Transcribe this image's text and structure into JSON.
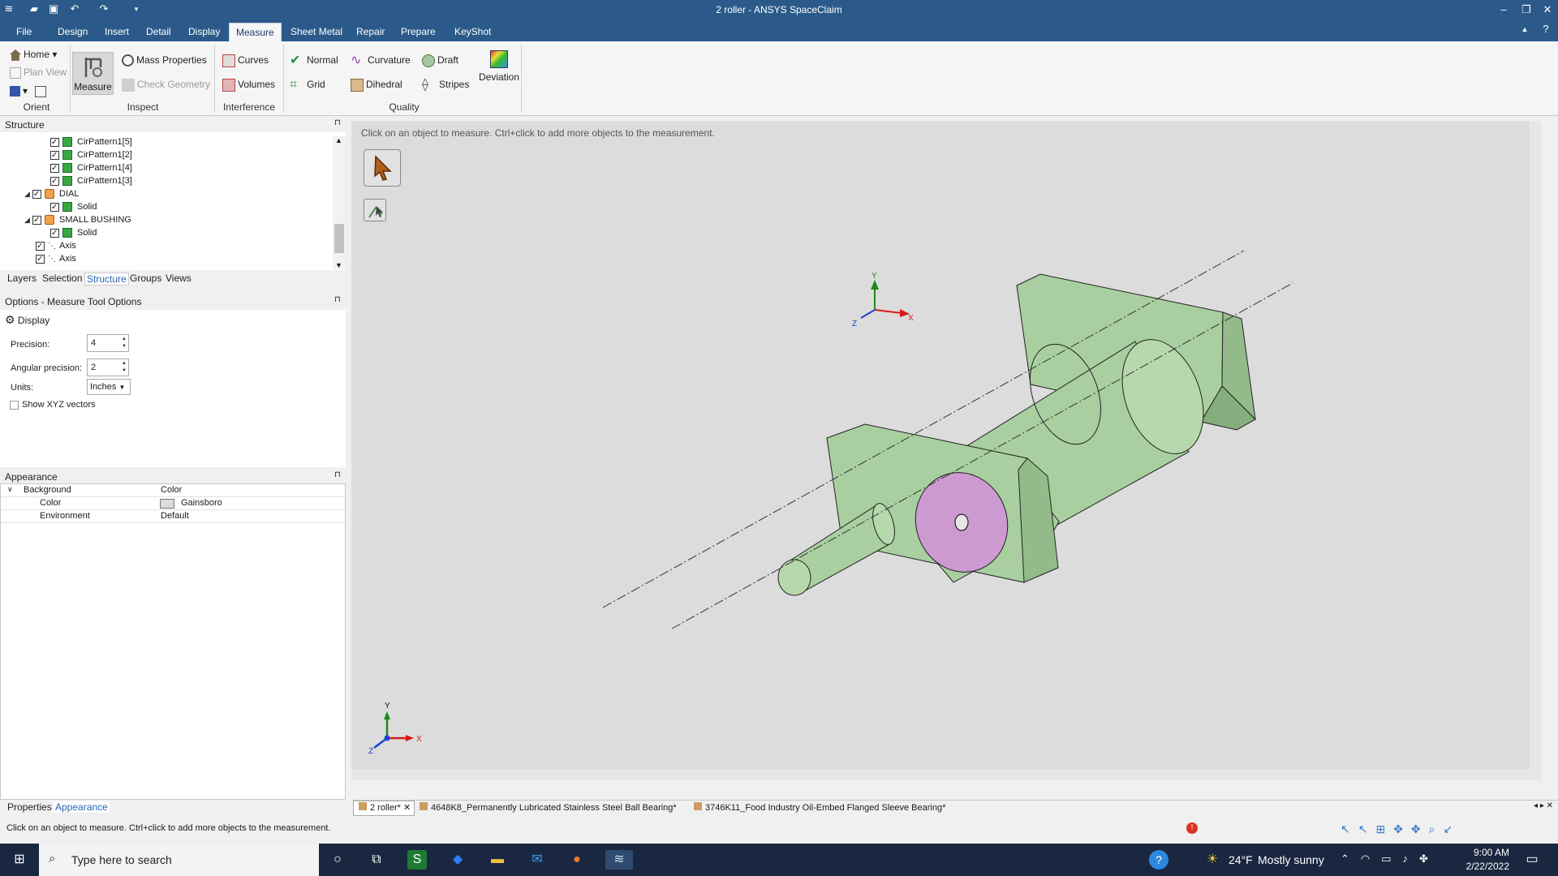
{
  "app": {
    "title": "2 roller - ANSYS SpaceClaim",
    "accent": "#2b5a8a"
  },
  "menu": {
    "tabs": [
      "File",
      "Design",
      "Insert",
      "Detail",
      "Display",
      "Measure",
      "Sheet Metal",
      "Repair",
      "Prepare",
      "KeyShot"
    ],
    "active": "Measure"
  },
  "ribbon": {
    "orient": {
      "home": "Home",
      "plan_view": "Plan View",
      "group": "Orient"
    },
    "inspect": {
      "measure": "Measure",
      "mass_properties": "Mass Properties",
      "check_geometry": "Check Geometry",
      "group": "Inspect"
    },
    "interference": {
      "curves": "Curves",
      "volumes": "Volumes",
      "group": "Interference"
    },
    "quality": {
      "normal": "Normal",
      "grid": "Grid",
      "curvature": "Curvature",
      "dihedral": "Dihedral",
      "draft": "Draft",
      "stripes": "Stripes",
      "deviation": "Deviation",
      "group": "Quality"
    }
  },
  "structure": {
    "title": "Structure",
    "items": [
      {
        "label": "CirPattern1[5]"
      },
      {
        "label": "CirPattern1[2]"
      },
      {
        "label": "CirPattern1[4]"
      },
      {
        "label": "CirPattern1[3]"
      },
      {
        "label": "DIAL"
      },
      {
        "label": "Solid"
      },
      {
        "label": "SMALL BUSHING"
      },
      {
        "label": "Solid"
      },
      {
        "label": "Axis"
      },
      {
        "label": "Axis"
      }
    ]
  },
  "panel_tabs": [
    "Layers",
    "Selection",
    "Structure",
    "Groups",
    "Views"
  ],
  "options": {
    "title": "Options - Measure Tool Options",
    "display": "Display",
    "precision_label": "Precision:",
    "precision_value": "4",
    "angular_label": "Angular precision:",
    "angular_value": "2",
    "units_label": "Units:",
    "units_value": "Inches",
    "xyz_label": "Show XYZ vectors"
  },
  "appearance": {
    "title": "Appearance",
    "header_name": "Background",
    "header_value": "Color",
    "rows": [
      {
        "name": "Color",
        "value": "Gainsboro"
      },
      {
        "name": "Environment",
        "value": "Default"
      }
    ]
  },
  "bottom_tabs": [
    "Properties",
    "Appearance"
  ],
  "viewport": {
    "hint": "Click on an object to measure.  Ctrl+click to add more objects to the measurement.",
    "axis_x": "X",
    "axis_y": "Y",
    "axis_z": "Z"
  },
  "doc_tabs": [
    "2 roller*",
    "4648K8_Permanently Lubricated Stainless Steel Ball Bearing*",
    "3746K11_Food Industry Oil-Embed Flanged Sleeve Bearing*"
  ],
  "status": {
    "text": "Click on an object to measure.  Ctrl+click to add more objects to the measurement."
  },
  "taskbar": {
    "search_placeholder": "Type here to search",
    "weather_temp": "24°F",
    "weather_text": "Mostly sunny",
    "time": "9:00 AM",
    "date": "2/22/2022"
  }
}
